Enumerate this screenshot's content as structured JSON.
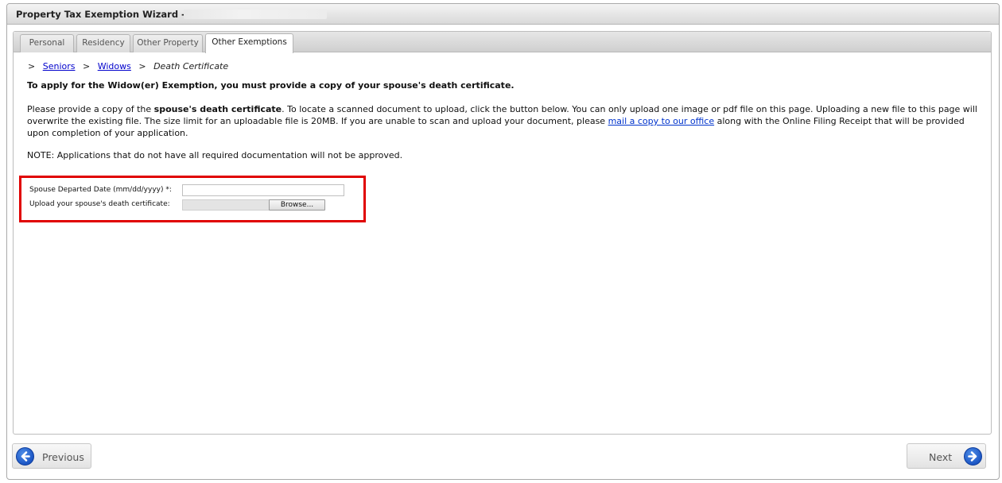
{
  "window": {
    "title": "Property Tax Exemption Wizard -"
  },
  "tabs": [
    {
      "label": "Personal"
    },
    {
      "label": "Residency"
    },
    {
      "label": "Other Property"
    },
    {
      "label": "Other Exemptions"
    }
  ],
  "breadcrumb": {
    "sep1": ">",
    "seniors": "Seniors",
    "sep2": ">",
    "widows": "Widows",
    "sep3": ">",
    "current": "Death Certificate"
  },
  "content": {
    "heading": "To apply for the Widow(er) Exemption, you must provide a copy of your spouse's death certificate.",
    "p1_a": "Please provide a copy of the ",
    "p1_bold": "spouse's death certificate",
    "p1_b": ". To locate a scanned document to upload, click the button below. You can only upload one image or pdf file on this page. Uploading a new file to this page will overwrite the existing file. The size limit for an uploadable file is 20MB. If you are unable to scan and upload your document, please ",
    "p1_link": "mail a copy to our office",
    "p1_c": " along with the Online Filing Receipt that will be provided upon completion of your application.",
    "note": "NOTE: Applications that do not have all required documentation will not be approved."
  },
  "form": {
    "date_label": "Spouse Departed Date (mm/dd/yyyy) *:",
    "date_value": "",
    "upload_label": "Upload your spouse's death certificate:",
    "browse_label": "Browse..."
  },
  "nav": {
    "previous_label": "Previous",
    "next_label": "Next"
  }
}
